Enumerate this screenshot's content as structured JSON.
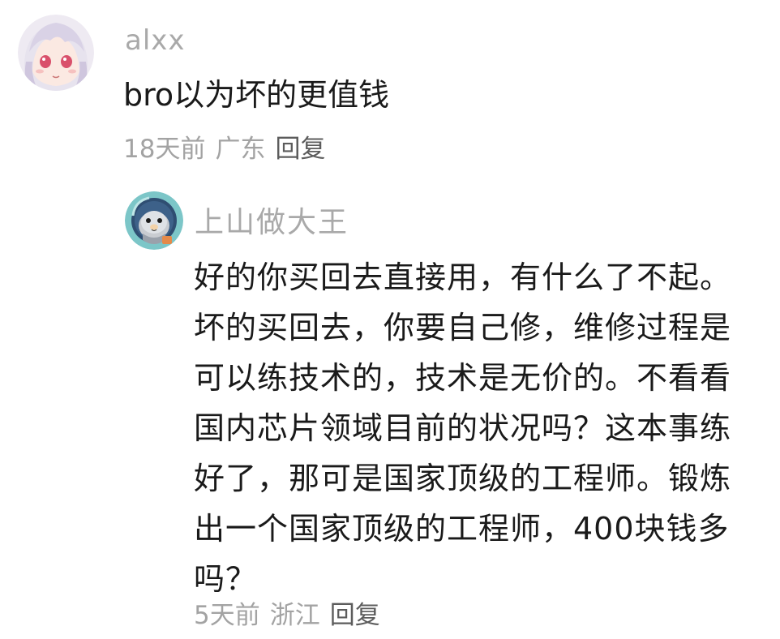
{
  "comments": [
    {
      "username": "alxx",
      "text": "bro以为坏的更值钱",
      "time": "18天前",
      "location": "广东",
      "reply_label": "回复"
    },
    {
      "username": "上山做大王",
      "text": "好的你买回去直接用，有什么了不起。坏的买回去，你要自己修，维修过程是可以练技术的，技术是无价的。不看看国内芯片领域目前的状况吗？这本事练好了，那可是国家顶级的工程师。锻炼出一个国家顶级的工程师，400块钱多吗？",
      "time": "5天前",
      "location": "浙江",
      "reply_label": "回复"
    }
  ]
}
